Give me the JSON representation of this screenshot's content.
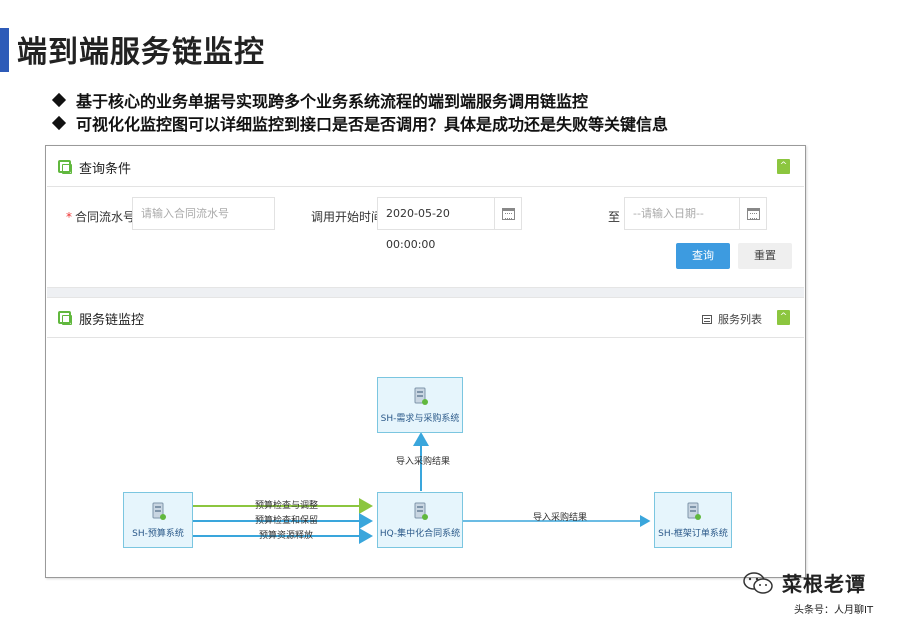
{
  "slide": {
    "title": "端到端服务链监控",
    "bullets": [
      "基于核心的业务单据号实现跨多个业务系统流程的端到端服务调用链监控",
      "可视化化监控图可以详细监控到接口是否是否调用？具体是成功还是失败等关键信息"
    ]
  },
  "query_panel": {
    "title": "查询条件",
    "collapse_label": "^",
    "contract_label": "合同流水号",
    "required_mark": "*",
    "contract_placeholder": "请输入合同流水号",
    "start_time_label": "调用开始时间",
    "start_time_value": "2020-05-20 00:00:00",
    "to_label": "至",
    "end_date_placeholder": "--请输入日期--",
    "query_button": "查询",
    "reset_button": "重置"
  },
  "monitor_panel": {
    "title": "服务链监控",
    "service_list_label": "服务列表",
    "collapse_label": "^"
  },
  "diagram": {
    "nodes": {
      "demand": "SH-需求与采购系统",
      "budget": "SH-预算系统",
      "contract": "HQ-集中化合同系统",
      "order": "SH-框架订单系统"
    },
    "edges": {
      "budget_check_adjust": "预算检查与调整",
      "budget_check_reserve": "预算检查和保留",
      "budget_release": "预算资源释放",
      "import_purchase_up": "导入采购结果",
      "import_purchase_right": "导入采购结果"
    },
    "colors": {
      "green_edge": "#8cc63f",
      "blue_edge": "#3aa6dc"
    }
  },
  "watermark": {
    "name": "菜根老谭",
    "sub": "头条号：人月聊IT"
  }
}
